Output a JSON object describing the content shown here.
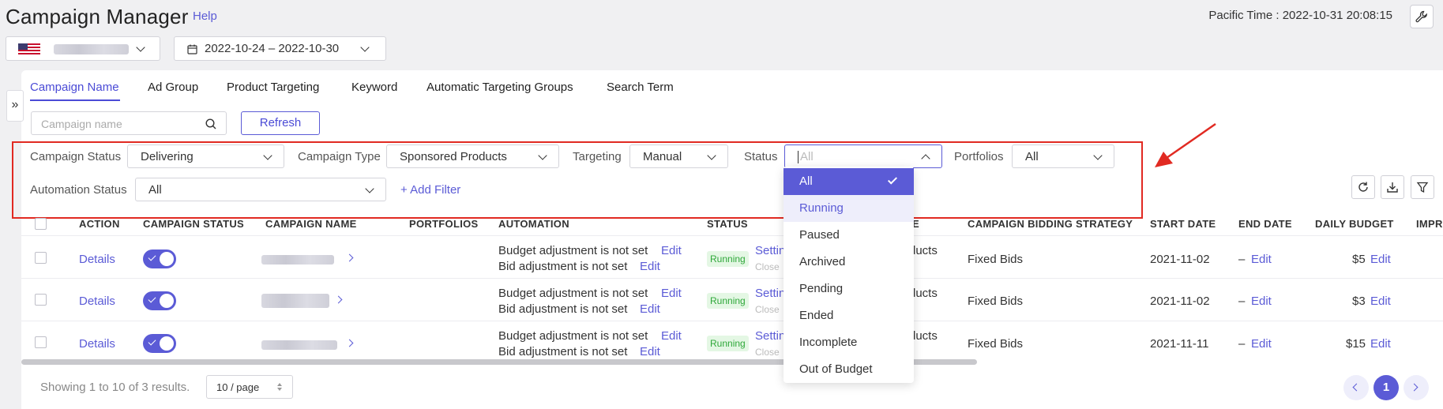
{
  "app": {
    "title": "Campaign Manager",
    "help_label": "Help",
    "pacific_time": "Pacific Time : 2022-10-31 20:08:15"
  },
  "toolbar": {
    "date_range": "2022-10-24 – 2022-10-30"
  },
  "tabs": [
    {
      "label": "Campaign Name",
      "active": true
    },
    {
      "label": "Ad Group"
    },
    {
      "label": "Product Targeting"
    },
    {
      "label": "Keyword"
    },
    {
      "label": "Automatic Targeting Groups"
    },
    {
      "label": "Search Term"
    }
  ],
  "search": {
    "placeholder": "Campaign name",
    "refresh_label": "Refresh"
  },
  "filters": {
    "campaign_status_label": "Campaign Status",
    "campaign_status_value": "Delivering",
    "campaign_type_label": "Campaign Type",
    "campaign_type_value": "Sponsored Products",
    "targeting_label": "Targeting",
    "targeting_value": "Manual",
    "status_label": "Status",
    "status_placeholder": "All",
    "portfolios_label": "Portfolios",
    "portfolios_value": "All",
    "automation_status_label": "Automation Status",
    "automation_status_value": "All",
    "add_filter_label": "+ Add Filter"
  },
  "status_dropdown": {
    "options": [
      "All",
      "Running",
      "Paused",
      "Archived",
      "Pending",
      "Ended",
      "Incomplete",
      "Out of Budget"
    ],
    "selected": "All",
    "hovered": "Running"
  },
  "table": {
    "headers": {
      "action": "ACTION",
      "campaign_status": "CAMPAIGN STATUS",
      "campaign_name": "CAMPAIGN NAME",
      "portfolios": "PORTFOLIOS",
      "automation": "AUTOMATION",
      "status": "STATUS",
      "type_tail": "E",
      "bidding": "CAMPAIGN BIDDING STRATEGY",
      "start": "START DATE",
      "end": "END DATE",
      "budget": "DAILY BUDGET",
      "impr": "IMPRE"
    },
    "rows": [
      {
        "details": "Details",
        "auto1": "Budget adjustment is not set",
        "auto2": "Bid adjustment is not set",
        "edit": "Edit",
        "status": "Running",
        "settings": "Settin",
        "close": "Close",
        "type_tail": "ducts",
        "bidding": "Fixed Bids",
        "start": "2021-11-02",
        "end": "–",
        "budget": "$5"
      },
      {
        "details": "Details",
        "auto1": "Budget adjustment is not set",
        "auto2": "Bid adjustment is not set",
        "edit": "Edit",
        "status": "Running",
        "settings": "Settin",
        "close": "Close",
        "type_tail": "ducts",
        "bidding": "Fixed Bids",
        "start": "2021-11-02",
        "end": "–",
        "budget": "$3"
      },
      {
        "details": "Details",
        "auto1": "Budget adjustment is not set",
        "auto2": "Bid adjustment is not set",
        "edit": "Edit",
        "status": "Running",
        "settings": "Settin",
        "close": "Close",
        "type_tail": "ducts",
        "bidding": "Fixed Bids",
        "start": "2021-11-11",
        "end": "–",
        "budget": "$15"
      }
    ]
  },
  "footer": {
    "showing": "Showing 1 to 10 of 3 results.",
    "per_page": "10 / page",
    "current_page": "1"
  },
  "colors": {
    "accent": "#5b5bd6",
    "annotation": "#e12a22",
    "running": "#2fa83a"
  }
}
